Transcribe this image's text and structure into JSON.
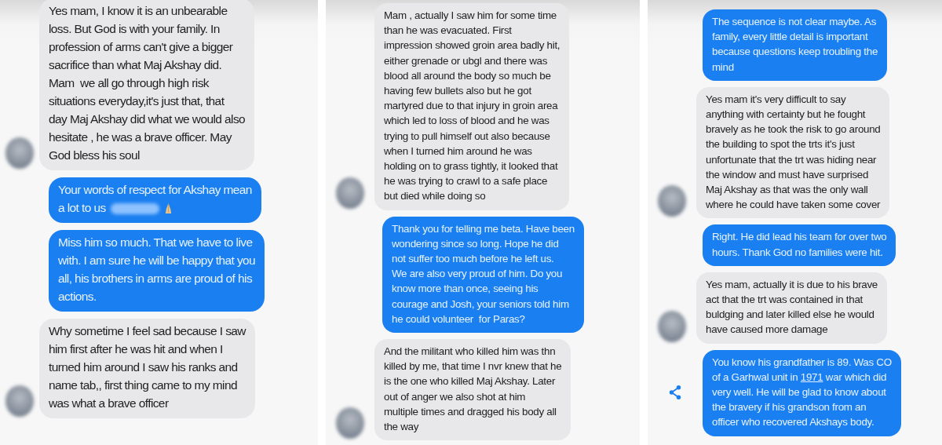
{
  "panels": [
    {
      "messages": [
        {
          "kind": "received",
          "avatar": true,
          "text": "Yes mam, I know it is an unbearable\nloss. But God is with your family. In\nprofession of arms can't give a bigger\nsacrifice than what Maj Akshay did.\nMam  we all go through high risk\nsituations everyday,it's just that, that\nday Maj Akshay did what we would also\nhesitate , he was a brave officer. May\nGod bless his soul"
        },
        {
          "kind": "sent",
          "text": "Your words of respect for Akshay mean\na lot to us",
          "redacted": true,
          "emoji": true
        },
        {
          "kind": "sent",
          "text": "Miss him so much. That we have to live\nwith. I am sure he will be happy that you\nall, his brothers in arms are proud of his\nactions."
        },
        {
          "kind": "received",
          "avatar": true,
          "text": "Why sometime I feel sad because I saw\nhim first after he was hit and when I\nturned him around I saw his ranks and\nname tab,, first thing came to my mind\nwas what a brave officer"
        }
      ]
    },
    {
      "messages": [
        {
          "kind": "received",
          "avatar": true,
          "text": "Mam , actually I saw him for some time\nthan he was evacuated. First\nimpression showed groin area badly hit,\neither grenade or ubgl and there was\nblood all around the body so much be\nhaving few bullets also but he got\nmartyred due to that injury in groin area\nwhich led to loss of blood and he was\ntrying to pull himself out also because\nwhen I turned him around he was\nholding on to grass tightly, it looked that\nhe was trying to crawl to a safe place\nbut died while doing so"
        },
        {
          "kind": "sent",
          "text": "Thank you for telling me beta. Have been\nwondering since so long. Hope he did\nnot suffer too much before he left us.\nWe are also very proud of him. Do you\nknow more than once, seeing his\ncourage and Josh, your seniors told him\nhe could volunteer  for Paras?"
        },
        {
          "kind": "received",
          "avatar": true,
          "text": "And the militant who killed him was thn\nkilled by me, that time I nvr knew that he\nis the one who killed Maj Akshay. Later\nout of anger we also shot at him\nmultiple times and dragged his body all\nthe way"
        }
      ]
    },
    {
      "messages": [
        {
          "kind": "sent",
          "text": "The sequence is not clear maybe. As\nfamily, every little detail is important\nbecause questions keep troubling the\nmind"
        },
        {
          "kind": "received",
          "avatar": true,
          "text": "Yes mam it's very difficult to say\nanything with certainty but he fought\nbravely as he took the risk to go around\nthe building to spot the trts it's just\nunfortunate that the trt was hiding near\nthe window and must have surprised\nMaj Akshay as that was the only wall\nwhere he could have taken some cover"
        },
        {
          "kind": "sent",
          "text": "Right. He did lead his team for over two\nhours. Thank God no families were hit."
        },
        {
          "kind": "received",
          "avatar": true,
          "text": "Yes mam, actually it is due to his brave\nact that the trt was contained in that\nbuldging and later killed else he would\nhave caused more damage"
        },
        {
          "kind": "sent",
          "share": true,
          "segments": [
            {
              "kind": "text",
              "text": "You know his grandfather is 89. Was CO\nof a Garhwal unit in "
            },
            {
              "kind": "link",
              "text": "1971"
            },
            {
              "kind": "text",
              "text": " war which did\nvery well. He will be glad to know about\nthe bravery if his grandson from an\nofficer who recovered Akshays body."
            }
          ]
        }
      ]
    }
  ]
}
